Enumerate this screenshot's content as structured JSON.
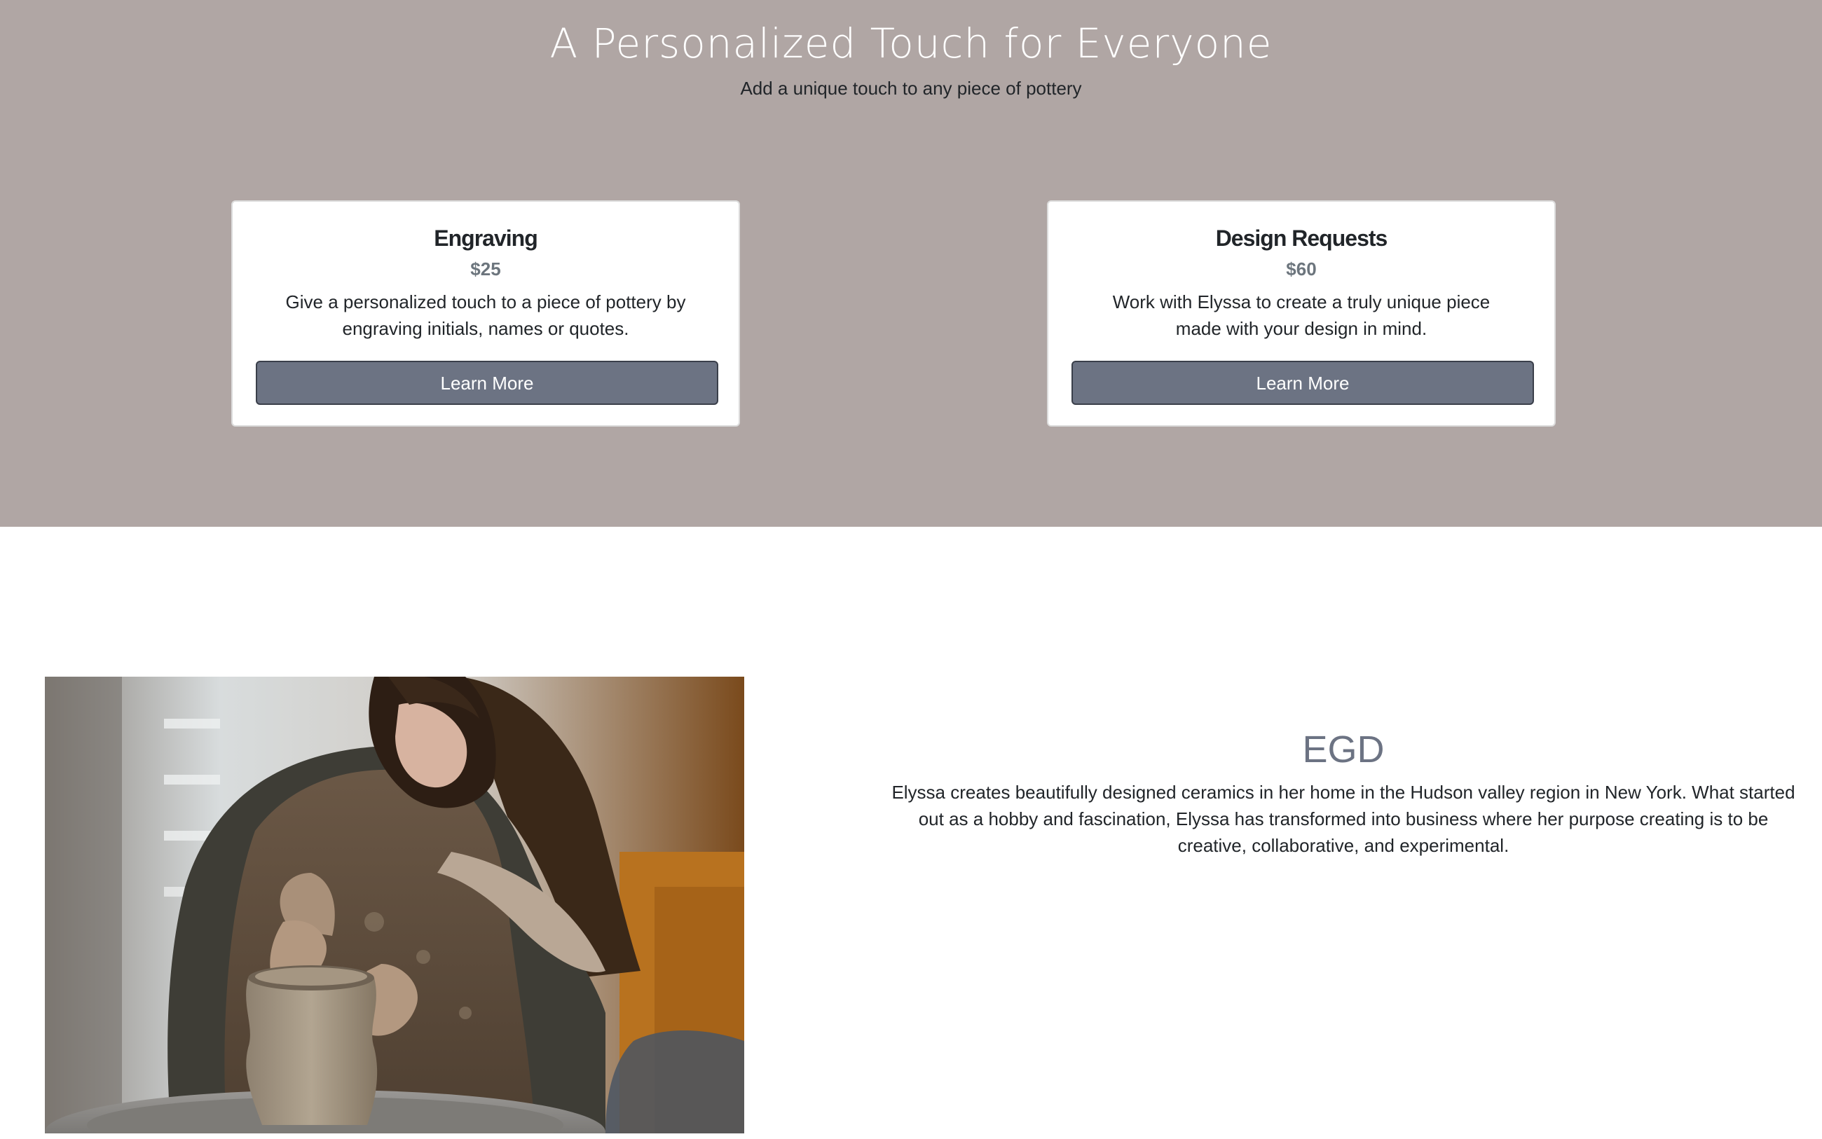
{
  "hero": {
    "title": "A Personalized Touch for Everyone",
    "subtitle": "Add a unique touch to any piece of pottery",
    "background_color": "#b0a6a4"
  },
  "services": [
    {
      "title": "Engraving",
      "price": "$25",
      "description": "Give a personalized touch to a piece of pottery by engraving initials, names or quotes.",
      "button_label": "Learn More"
    },
    {
      "title": "Design Requests",
      "price": "$60",
      "description": "Work with Elyssa to create a truly unique piece made with your design in mind.",
      "button_label": "Learn More"
    }
  ],
  "about": {
    "title": "EGD",
    "text": "Elyssa creates beautifully designed ceramics in her home in the Hudson valley region in New York. What started out as a hobby and fascination, Elyssa has transformed into business where her purpose creating is to be creative, collaborative, and experimental.",
    "image_icon": "potter-at-wheel-photo"
  },
  "colors": {
    "button": "#6c7383",
    "price": "#6c757d",
    "about_title": "#6c7383"
  }
}
